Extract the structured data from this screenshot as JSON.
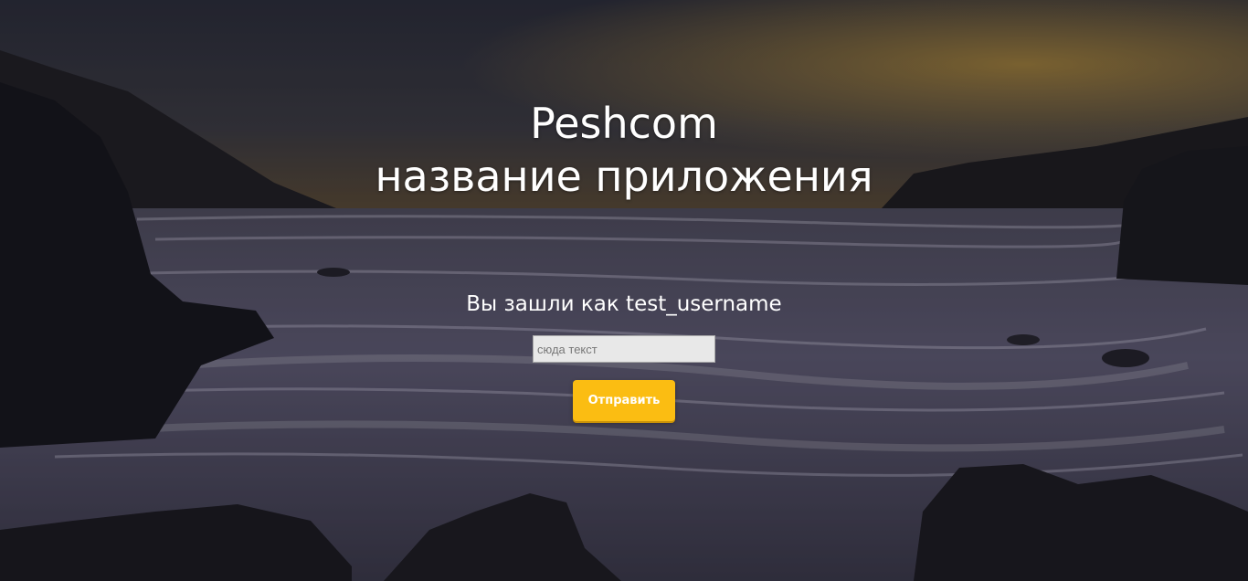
{
  "header": {
    "title_line1": "Peshcom",
    "title_line2": "название приложения"
  },
  "session": {
    "logged_in_text": "Вы зашли как test_username"
  },
  "form": {
    "input_value": "",
    "input_placeholder": "сюда текст",
    "submit_label": "Отправить"
  },
  "colors": {
    "button_bg": "#fbbd12",
    "text": "#ffffff",
    "input_bg": "#e8e8e8"
  }
}
